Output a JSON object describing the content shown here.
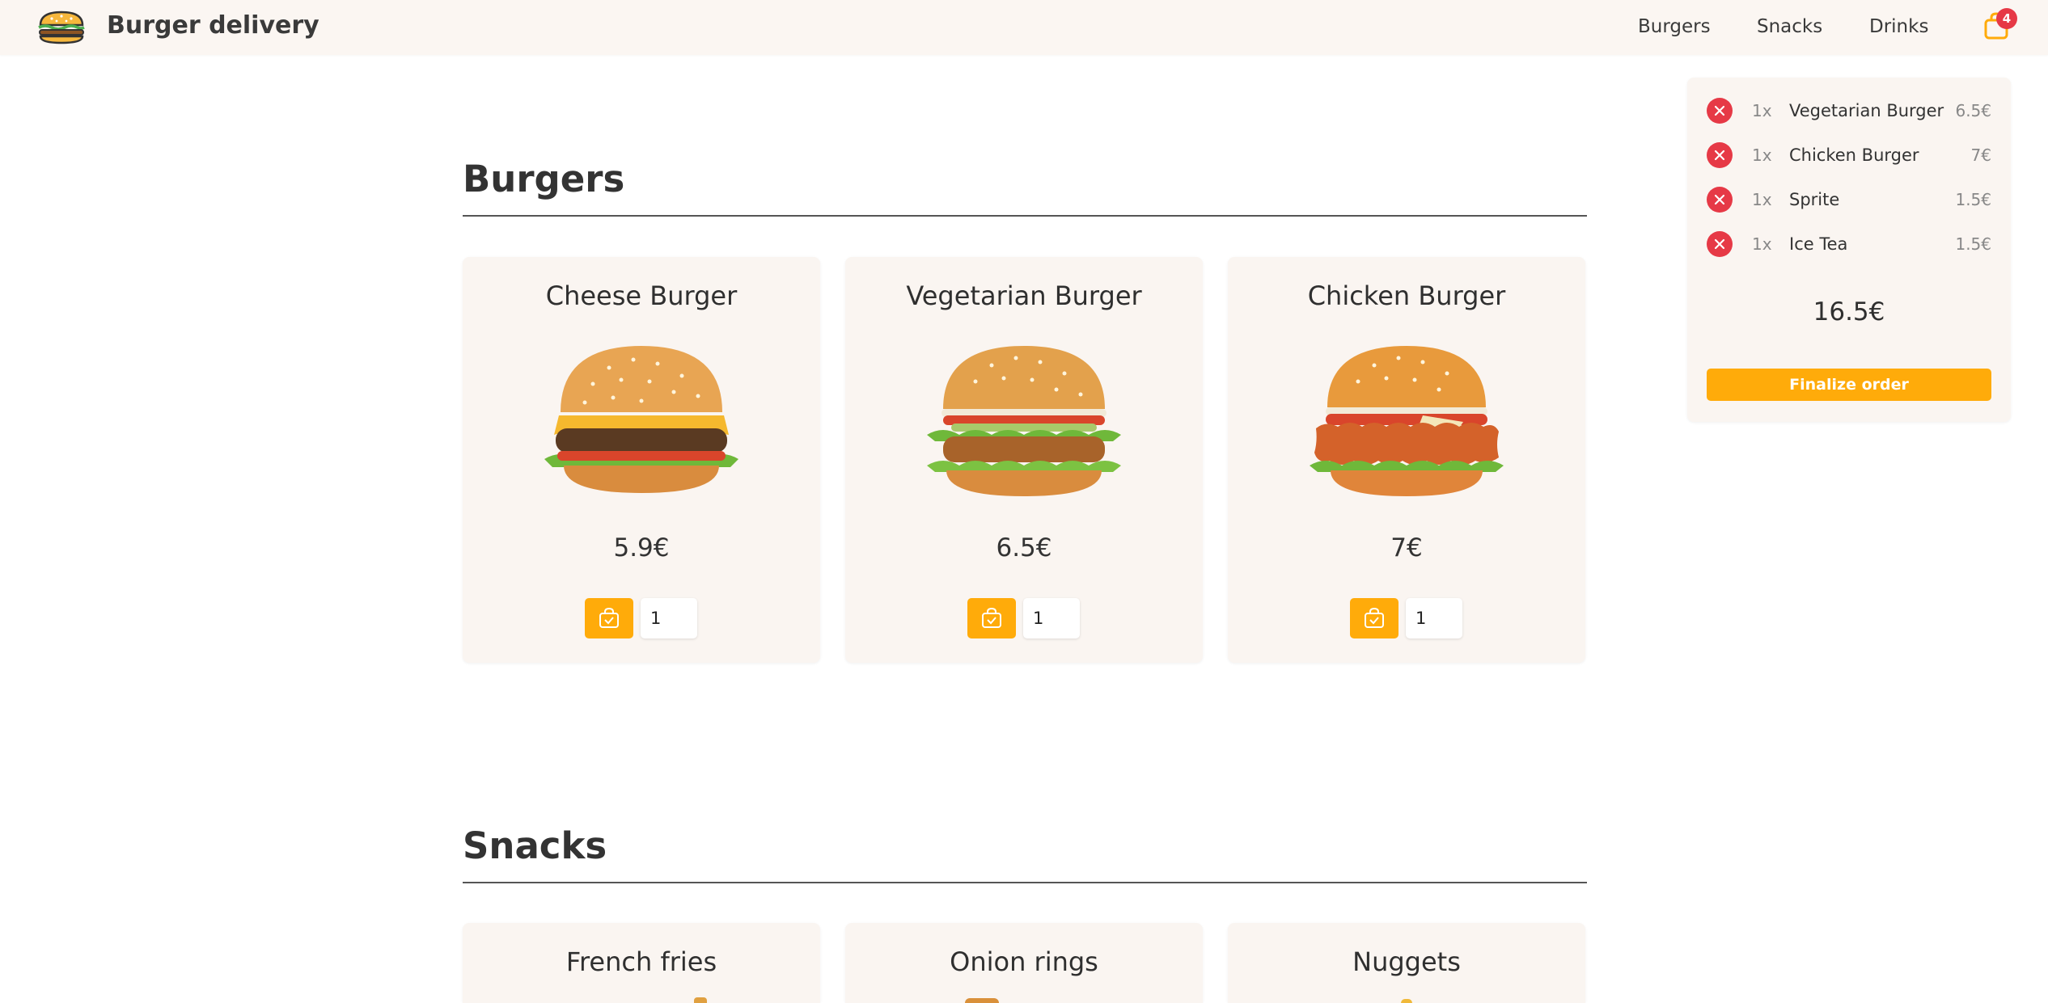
{
  "header": {
    "brand": "Burger delivery",
    "nav": [
      "Burgers",
      "Snacks",
      "Drinks"
    ],
    "cart_count": "4"
  },
  "sections": [
    {
      "title": "Burgers",
      "items": [
        {
          "name": "Cheese Burger",
          "price": "5.9€",
          "quantity": "1"
        },
        {
          "name": "Vegetarian Burger",
          "price": "6.5€",
          "quantity": "1"
        },
        {
          "name": "Chicken Burger",
          "price": "7€",
          "quantity": "1"
        }
      ]
    },
    {
      "title": "Snacks",
      "items": [
        {
          "name": "French fries"
        },
        {
          "name": "Onion rings"
        },
        {
          "name": "Nuggets"
        }
      ]
    }
  ],
  "basket": {
    "items": [
      {
        "qty": "1x",
        "name": "Vegetarian Burger",
        "price": "6.5€"
      },
      {
        "qty": "1x",
        "name": "Chicken Burger",
        "price": "7€"
      },
      {
        "qty": "1x",
        "name": "Sprite",
        "price": "1.5€"
      },
      {
        "qty": "1x",
        "name": "Ice Tea",
        "price": "1.5€"
      }
    ],
    "total": "16.5€",
    "finalize_label": "Finalize order"
  },
  "colors": {
    "accent": "#ffab0a",
    "remove": "#e63946",
    "card_bg": "#faf5f1",
    "header_bg": "#fbf6f2"
  }
}
